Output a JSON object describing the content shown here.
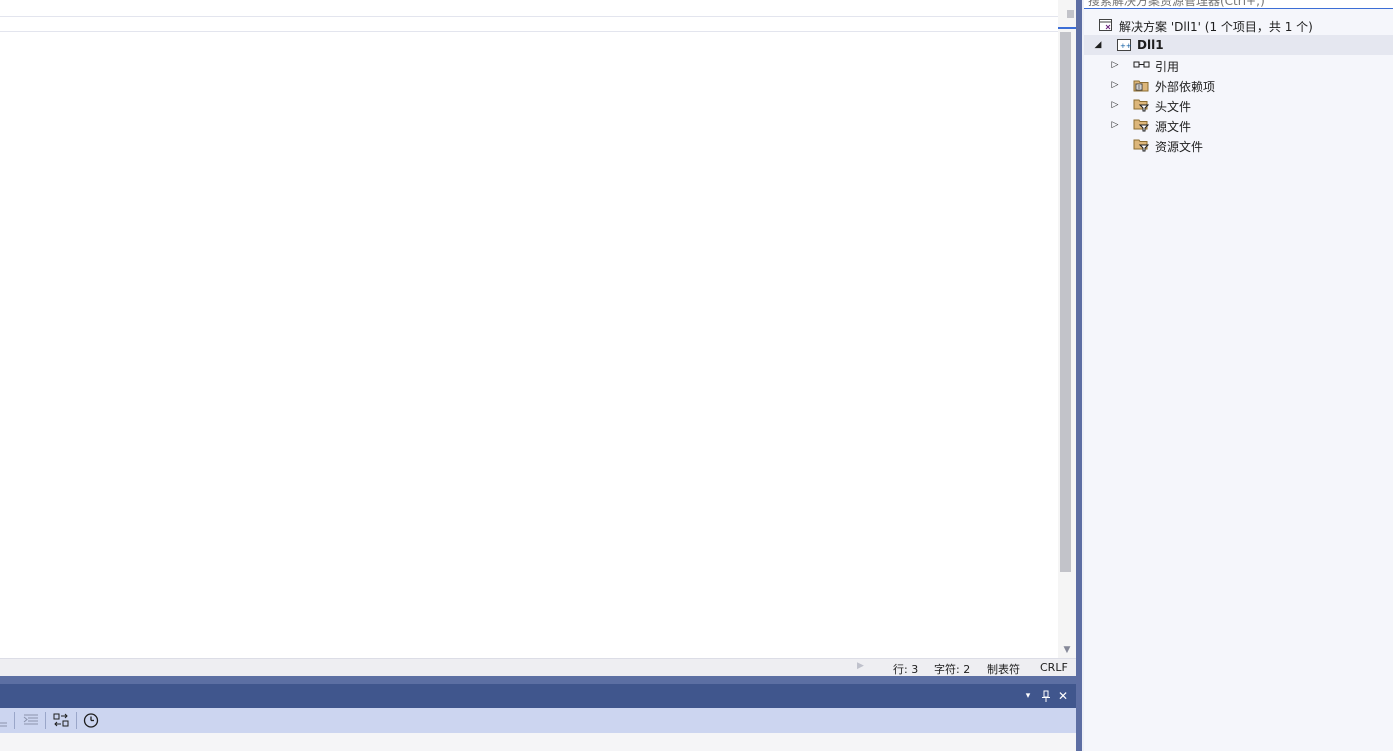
{
  "editor": {
    "status_bar": {
      "line": "行: 3",
      "char": "字符: 2",
      "tabs": "制表符",
      "eol": "CRLF"
    }
  },
  "bottom_panel": {
    "title_buttons": {
      "dropdown": "▾",
      "pin": "⊥",
      "close": "✕"
    }
  },
  "solution_explorer": {
    "search_placeholder": "搜索解决方案资源管理器(Ctrl+;)",
    "solution_label": "解决方案 'Dll1' (1 个项目，共 1 个)",
    "project_label": "Dll1",
    "nodes": [
      {
        "label": "引用",
        "icon": "references-icon",
        "expandable": true
      },
      {
        "label": "外部依赖项",
        "icon": "external-deps-icon",
        "expandable": true
      },
      {
        "label": "头文件",
        "icon": "filter-folder-icon",
        "expandable": true
      },
      {
        "label": "源文件",
        "icon": "filter-folder-icon",
        "expandable": true
      },
      {
        "label": "资源文件",
        "icon": "filter-folder-icon",
        "expandable": false
      }
    ]
  },
  "colors": {
    "accent": "#3c6ed6",
    "panel_title": "#40568d",
    "toolbar": "#ccd5f0",
    "folder": "#d89c3b"
  }
}
